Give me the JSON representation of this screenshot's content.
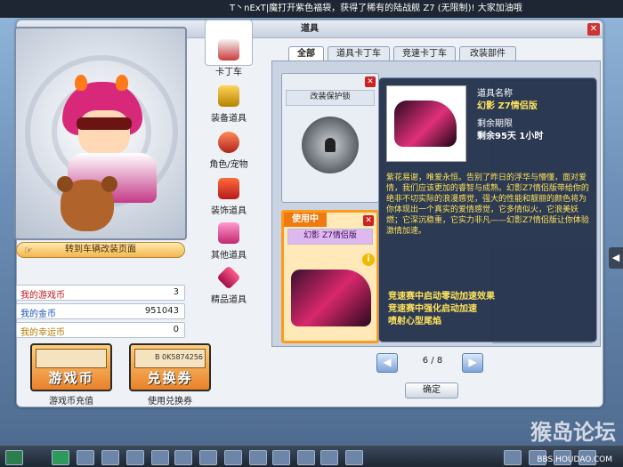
{
  "ticker": {
    "text": "T丶nExT|魔打开紫色福袋，获得了稀有的陆战舰 Z7 (无限制)! 大家加油哦"
  },
  "window": {
    "title": "道具",
    "close_label": "✕"
  },
  "preview": {
    "go_button": "转到车辆改装页面"
  },
  "currencies": [
    {
      "label": "我的游戏币",
      "value": "3"
    },
    {
      "label": "我的金币",
      "value": "951043"
    },
    {
      "label": "我的幸运币",
      "value": "0"
    }
  ],
  "big_buttons": {
    "game_coin": {
      "text": "游戏币",
      "caption": "游戏币充值"
    },
    "voucher": {
      "text": "兑换券",
      "caption": "使用兑换券",
      "code": "B 0K5874256"
    }
  },
  "categories": [
    {
      "label": "卡丁车",
      "icon": "kart-icon"
    },
    {
      "label": "装备道具",
      "icon": "equipment-icon"
    },
    {
      "label": "角色/宠物",
      "icon": "character-pet-icon"
    },
    {
      "label": "装饰道具",
      "icon": "decoration-icon"
    },
    {
      "label": "其他道具",
      "icon": "other-items-icon"
    },
    {
      "label": "精品道具",
      "icon": "premium-items-icon"
    }
  ],
  "tabs": [
    {
      "label": "全部",
      "active": true
    },
    {
      "label": "道具卡丁车",
      "active": false
    },
    {
      "label": "竞速卡丁车",
      "active": false
    },
    {
      "label": "改装部件",
      "active": false
    }
  ],
  "slots": {
    "lock": {
      "name": "改装保护锁"
    },
    "equipped": {
      "badge": "使用中",
      "name": "幻影 Z7情侣版"
    }
  },
  "tooltip": {
    "name_header": "道具名称",
    "name": "幻影 Z7情侣版",
    "expiry_label": "剩余期限",
    "expiry_value": "剩余95天 1小时",
    "description": "紫花易谢，唯爱永恒。告别了昨日的浮华与懵懂，面对爱情，我们应该更加的睿智与成熟。幻影Z7情侣版带给你的绝非不切实际的浪漫感觉，强大的性能和靓丽的颜色将为你体现出一个真实的爱情感觉，它多情似火，它浪美妖燃；它深沉稳重，它实力非凡——幻影Z7情侣版让你体验激情加速。",
    "effects": [
      "竞速赛中启动零动加速效果",
      "竞速赛中强化启动加速",
      "喷射心型尾焰"
    ]
  },
  "pager": {
    "prev": "◀",
    "next": "▶",
    "page_text": "6 / 8"
  },
  "ok_button": "确定",
  "side_arrow": "◀",
  "watermark": {
    "title": "猴岛论坛",
    "url": "BBS.HOUDAO.COM"
  },
  "colors": {
    "accent": "#f07a10",
    "tooltip_text": "#ffe35a"
  }
}
